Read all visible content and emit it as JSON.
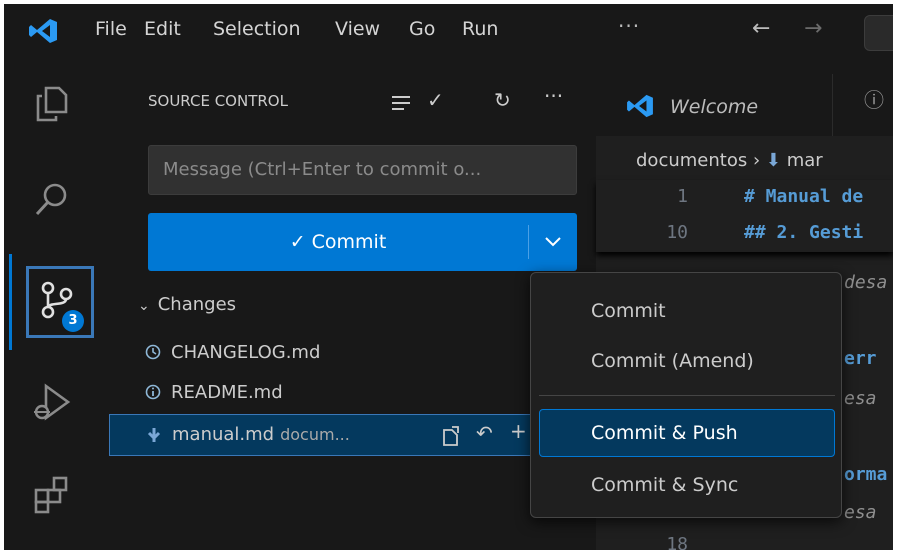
{
  "menubar": {
    "items": [
      "File",
      "Edit",
      "Selection",
      "View",
      "Go",
      "Run"
    ],
    "more": "···"
  },
  "activity": {
    "scm_badge": "3"
  },
  "sidebar": {
    "title": "SOURCE CONTROL",
    "message_placeholder": "Message (Ctrl+Enter to commit o...",
    "commit_label": "✓ Commit",
    "changes_label": "Changes",
    "files": [
      {
        "name": "CHANGELOG.md"
      },
      {
        "name": "README.md"
      },
      {
        "name": "manual.md",
        "path": "docum..."
      }
    ]
  },
  "editor": {
    "tab_welcome": "Welcome",
    "breadcrumb_folder": "documentos",
    "breadcrumb_file": "mar",
    "lines": [
      {
        "num": "1",
        "code": "# Manual de"
      },
      {
        "num": "10",
        "code": "## 2. Gesti"
      },
      {
        "num": "",
        "code": "desa"
      },
      {
        "num": "",
        "code": "err"
      },
      {
        "num": "",
        "code": "esa"
      },
      {
        "num": "",
        "code": "orma"
      },
      {
        "num": "",
        "code": "esa"
      },
      {
        "num": "18",
        "code": ""
      }
    ]
  },
  "commit_menu": {
    "items": [
      "Commit",
      "Commit (Amend)",
      "Commit & Push",
      "Commit & Sync"
    ],
    "highlighted": "Commit & Push"
  },
  "colors": {
    "accent": "#0078d4",
    "selection": "#04395e",
    "background": "#1f1f1f",
    "keyword": "#569cd6"
  }
}
